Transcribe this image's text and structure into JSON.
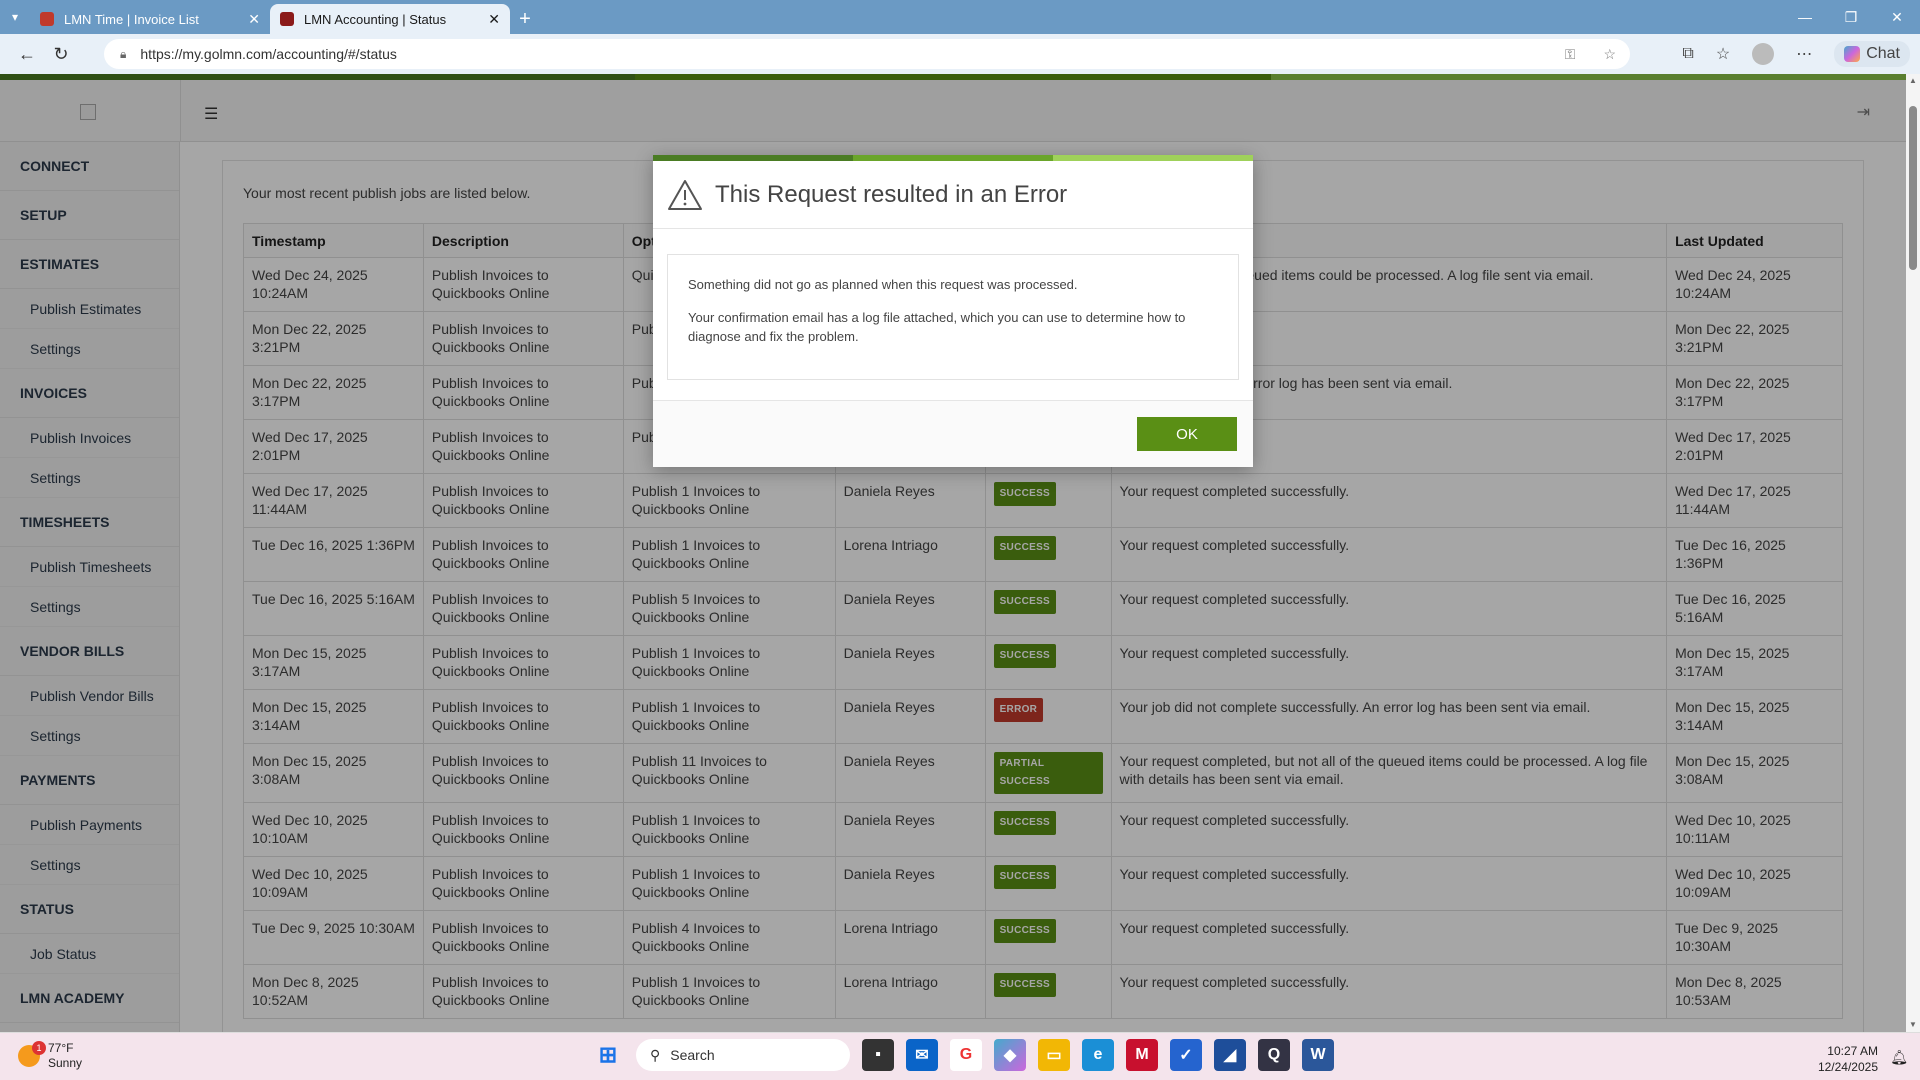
{
  "browser": {
    "tabs": [
      {
        "title": "LMN Time | Invoice List",
        "active": false
      },
      {
        "title": "LMN Accounting | Status",
        "active": true
      }
    ],
    "url": "https://my.golmn.com/accounting/#/status",
    "chat_label": "Chat"
  },
  "colors": {
    "accent": "#5a8f15",
    "error": "#c0392b",
    "tabbar": "#6b9ac4"
  },
  "sidebar": {
    "sections": [
      {
        "label": "CONNECT",
        "items": []
      },
      {
        "label": "SETUP",
        "items": []
      },
      {
        "label": "ESTIMATES",
        "items": [
          "Publish Estimates",
          "Settings"
        ]
      },
      {
        "label": "INVOICES",
        "items": [
          "Publish Invoices",
          "Settings"
        ]
      },
      {
        "label": "TIMESHEETS",
        "items": [
          "Publish Timesheets",
          "Settings"
        ]
      },
      {
        "label": "VENDOR BILLS",
        "items": [
          "Publish Vendor Bills",
          "Settings"
        ]
      },
      {
        "label": "PAYMENTS",
        "items": [
          "Publish Payments",
          "Settings"
        ]
      },
      {
        "label": "STATUS",
        "items": [
          "Job Status"
        ]
      },
      {
        "label": "LMN ACADEMY",
        "items": []
      }
    ]
  },
  "main": {
    "intro": "Your most recent publish jobs are listed below.",
    "columns": [
      "Timestamp",
      "Description",
      "Opt",
      "",
      "",
      "",
      "Last Updated"
    ],
    "rows": [
      {
        "ts": "Wed Dec 24, 2025 10:24AM",
        "desc": "Publish Invoices to Quickbooks Online",
        "opt": "Qui",
        "user": "",
        "status": "",
        "status_type": "",
        "msg": ", but not all of the queued items could be processed. A log file sent via email.",
        "updated": "Wed Dec 24, 2025 10:24AM"
      },
      {
        "ts": "Mon Dec 22, 2025 3:21PM",
        "desc": "Publish Invoices to Quickbooks Online",
        "opt": "Pub Qui",
        "user": "",
        "status": "",
        "status_type": "",
        "msg": "d successfully.",
        "updated": "Mon Dec 22, 2025 3:21PM"
      },
      {
        "ts": "Mon Dec 22, 2025 3:17PM",
        "desc": "Publish Invoices to Quickbooks Online",
        "opt": "Pub Qui",
        "user": "",
        "status": "",
        "status_type": "",
        "msg": "ete successfully. An error log has been sent via email.",
        "updated": "Mon Dec 22, 2025 3:17PM"
      },
      {
        "ts": "Wed Dec 17, 2025 2:01PM",
        "desc": "Publish Invoices to Quickbooks Online",
        "opt": "Pub Qui",
        "user": "",
        "status": "",
        "status_type": "",
        "msg": "d successfully.",
        "updated": "Wed Dec 17, 2025 2:01PM"
      },
      {
        "ts": "Wed Dec 17, 2025 11:44AM",
        "desc": "Publish Invoices to Quickbooks Online",
        "opt": "Publish 1 Invoices to Quickbooks Online",
        "user": "Daniela Reyes",
        "status": "SUCCESS",
        "status_type": "success",
        "msg": "Your request completed successfully.",
        "updated": "Wed Dec 17, 2025 11:44AM"
      },
      {
        "ts": "Tue Dec 16, 2025 1:36PM",
        "desc": "Publish Invoices to Quickbooks Online",
        "opt": "Publish 1 Invoices to Quickbooks Online",
        "user": "Lorena Intriago",
        "status": "SUCCESS",
        "status_type": "success",
        "msg": "Your request completed successfully.",
        "updated": "Tue Dec 16, 2025 1:36PM"
      },
      {
        "ts": "Tue Dec 16, 2025 5:16AM",
        "desc": "Publish Invoices to Quickbooks Online",
        "opt": "Publish 5 Invoices to Quickbooks Online",
        "user": "Daniela Reyes",
        "status": "SUCCESS",
        "status_type": "success",
        "msg": "Your request completed successfully.",
        "updated": "Tue Dec 16, 2025 5:16AM"
      },
      {
        "ts": "Mon Dec 15, 2025 3:17AM",
        "desc": "Publish Invoices to Quickbooks Online",
        "opt": "Publish 1 Invoices to Quickbooks Online",
        "user": "Daniela Reyes",
        "status": "SUCCESS",
        "status_type": "success",
        "msg": "Your request completed successfully.",
        "updated": "Mon Dec 15, 2025 3:17AM"
      },
      {
        "ts": "Mon Dec 15, 2025 3:14AM",
        "desc": "Publish Invoices to Quickbooks Online",
        "opt": "Publish 1 Invoices to Quickbooks Online",
        "user": "Daniela Reyes",
        "status": "ERROR",
        "status_type": "error",
        "msg": "Your job did not complete successfully. An error log has been sent via email.",
        "updated": "Mon Dec 15, 2025 3:14AM"
      },
      {
        "ts": "Mon Dec 15, 2025 3:08AM",
        "desc": "Publish Invoices to Quickbooks Online",
        "opt": "Publish 11 Invoices to Quickbooks Online",
        "user": "Daniela Reyes",
        "status": "PARTIAL SUCCESS",
        "status_type": "partial",
        "msg": "Your request completed, but not all of the queued items could be processed. A log file with details has been sent via email.",
        "updated": "Mon Dec 15, 2025 3:08AM"
      },
      {
        "ts": "Wed Dec 10, 2025 10:10AM",
        "desc": "Publish Invoices to Quickbooks Online",
        "opt": "Publish 1 Invoices to Quickbooks Online",
        "user": "Daniela Reyes",
        "status": "SUCCESS",
        "status_type": "success",
        "msg": "Your request completed successfully.",
        "updated": "Wed Dec 10, 2025 10:11AM"
      },
      {
        "ts": "Wed Dec 10, 2025 10:09AM",
        "desc": "Publish Invoices to Quickbooks Online",
        "opt": "Publish 1 Invoices to Quickbooks Online",
        "user": "Daniela Reyes",
        "status": "SUCCESS",
        "status_type": "success",
        "msg": "Your request completed successfully.",
        "updated": "Wed Dec 10, 2025 10:09AM"
      },
      {
        "ts": "Tue Dec 9, 2025 10:30AM",
        "desc": "Publish Invoices to Quickbooks Online",
        "opt": "Publish 4 Invoices to Quickbooks Online",
        "user": "Lorena Intriago",
        "status": "SUCCESS",
        "status_type": "success",
        "msg": "Your request completed successfully.",
        "updated": "Tue Dec 9, 2025 10:30AM"
      },
      {
        "ts": "Mon Dec 8, 2025 10:52AM",
        "desc": "Publish Invoices to Quickbooks Online",
        "opt": "Publish 1 Invoices to Quickbooks Online",
        "user": "Lorena Intriago",
        "status": "SUCCESS",
        "status_type": "success",
        "msg": "Your request completed successfully.",
        "updated": "Mon Dec 8, 2025 10:53AM"
      }
    ]
  },
  "modal": {
    "title": "This Request resulted in an Error",
    "line1": "Something did not go as planned when this request was processed.",
    "line2": "Your confirmation email has a log file attached, which you can use to determine how to diagnose and fix the problem.",
    "ok_label": "OK"
  },
  "taskbar": {
    "temp": "77°F",
    "condition": "Sunny",
    "weather_badge": "1",
    "search_label": "Search",
    "time": "10:27 AM",
    "date": "12/24/2025"
  }
}
